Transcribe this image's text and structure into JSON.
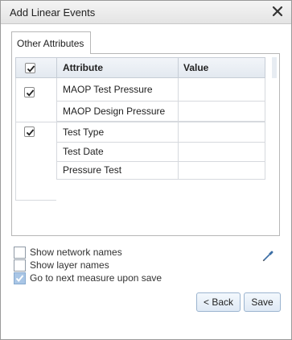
{
  "window": {
    "title": "Add Linear Events"
  },
  "tabs": [
    {
      "label": "Other Attributes"
    }
  ],
  "grid": {
    "columns": {
      "attribute": "Attribute",
      "value": "Value"
    },
    "rows": [
      {
        "attribute": "MAOP Test Pressure",
        "value": ""
      },
      {
        "attribute": "MAOP Design Pressure",
        "value": ""
      },
      {
        "attribute": "Test Type",
        "value": ""
      },
      {
        "attribute": "Test Date",
        "value": ""
      },
      {
        "attribute": "Pressure Test",
        "value": ""
      }
    ],
    "header_checked": true,
    "group_checks": [
      true,
      true
    ]
  },
  "options": [
    {
      "label": "Show network names",
      "checked": false
    },
    {
      "label": "Show layer names",
      "checked": false
    },
    {
      "label": "Go to next measure upon save",
      "checked": true
    }
  ],
  "buttons": {
    "back": "< Back",
    "save": "Save"
  },
  "colors": {
    "accent": "#a9c6e6",
    "header_bg": "#e3e9f0",
    "border": "#b7b7b7"
  },
  "icons": {
    "close": "close-icon",
    "picker": "eyedropper-icon",
    "check": "checkmark-icon"
  }
}
